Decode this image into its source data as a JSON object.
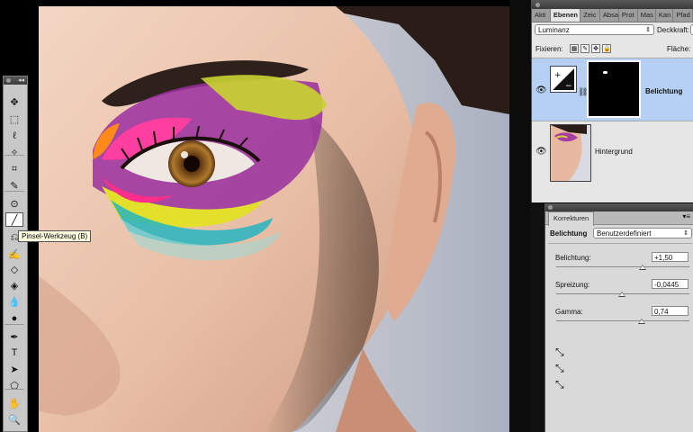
{
  "tools": {
    "items": [
      "move-icon",
      "marquee-icon",
      "lasso-icon",
      "magic-wand-icon",
      "crop-icon",
      "eyedropper-icon",
      "spot-heal-icon",
      "brush-icon",
      "stamp-icon",
      "history-brush-icon",
      "eraser-icon",
      "fill-icon",
      "blur-icon",
      "dodge-icon",
      "pen-icon",
      "type-icon",
      "path-select-icon",
      "shape-icon",
      "hand-icon",
      "zoom-icon"
    ],
    "glyphs": [
      "✥",
      "⬚",
      "ℓ",
      "✧",
      "⌗",
      "✎",
      "⊙",
      "╱",
      "⎌",
      "✍",
      "◇",
      "◈",
      "💧",
      "●",
      "✒",
      "T",
      "➤",
      "⬠",
      "✋",
      "🔍"
    ],
    "title_glyph": "◂◂",
    "tooltip": "Pinsel-Werkzeug (B)"
  },
  "layers": {
    "tabs": [
      "Akti",
      "Ebenen",
      "Zeic",
      "Absa",
      "Prot",
      "Mas",
      "Kan",
      "Pfad"
    ],
    "active_tab": "Ebenen",
    "blend_mode": "Luminanz",
    "opacity_label": "Deckkraft:",
    "lock_label": "Fixieren:",
    "fill_label": "Fläche:",
    "items": [
      {
        "name": "Belichtung",
        "selected": true
      },
      {
        "name": "Hintergrund",
        "selected": false
      }
    ]
  },
  "adjustments": {
    "tab": "Korrekturen",
    "menu_glyph": "▾≡",
    "type_label": "Belichtung",
    "preset": "Benutzerdefiniert",
    "sliders": [
      {
        "label": "Belichtung:",
        "value": "+1,50",
        "pos": 0.65
      },
      {
        "label": "Spreizung:",
        "value": "-0,0445",
        "pos": 0.49
      },
      {
        "label": "Gamma:",
        "value": "0,74",
        "pos": 0.64
      }
    ]
  }
}
